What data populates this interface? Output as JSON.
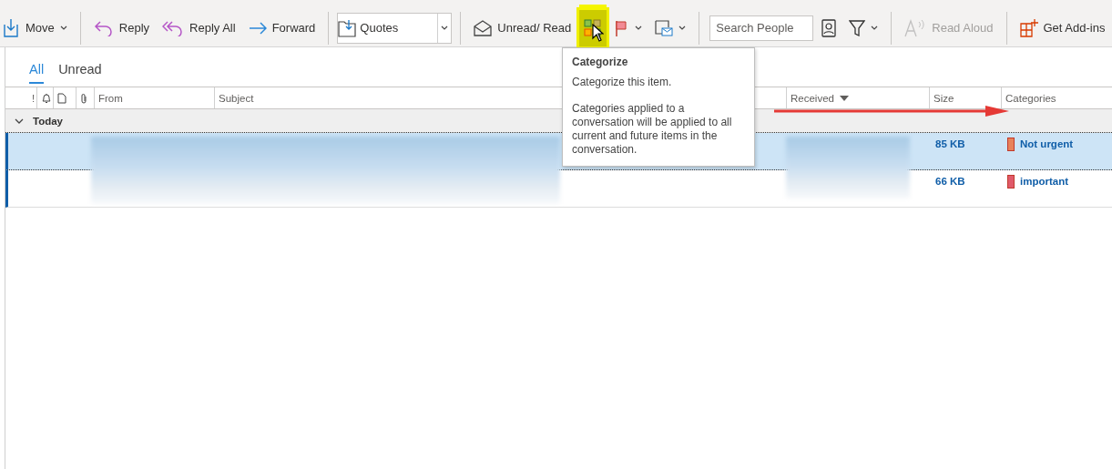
{
  "toolbar": {
    "groups": [
      [
        {
          "kind": "button",
          "label": "Move",
          "dropdown": true,
          "disabled": false,
          "highlighted": false
        }
      ],
      [
        {
          "kind": "button",
          "label": "Reply",
          "dropdown": false,
          "disabled": false,
          "highlighted": false
        },
        {
          "kind": "button",
          "label": "Reply All",
          "dropdown": false,
          "disabled": false,
          "highlighted": false
        },
        {
          "kind": "button",
          "label": "Forward",
          "dropdown": false,
          "disabled": false,
          "highlighted": false
        }
      ],
      [
        {
          "kind": "combo",
          "label": "Quotes"
        }
      ],
      [
        {
          "kind": "button",
          "label": "Unread/ Read",
          "dropdown": false,
          "disabled": false,
          "highlighted": false
        },
        {
          "kind": "icon",
          "dropdown": false,
          "disabled": false,
          "highlighted": true
        },
        {
          "kind": "icon",
          "dropdown": true,
          "disabled": false,
          "highlighted": false
        },
        {
          "kind": "icon",
          "dropdown": true,
          "disabled": false,
          "highlighted": false
        }
      ],
      [
        {
          "kind": "search",
          "placeholder": "Search People"
        },
        {
          "kind": "icon",
          "dropdown": false,
          "disabled": false,
          "highlighted": false
        },
        {
          "kind": "icon",
          "dropdown": true,
          "disabled": false,
          "highlighted": false
        }
      ],
      [
        {
          "kind": "button",
          "label": "Read Aloud",
          "dropdown": false,
          "disabled": true,
          "highlighted": false
        }
      ],
      [
        {
          "kind": "button",
          "label": "Get Add-ins",
          "dropdown": false,
          "disabled": false,
          "highlighted": false
        }
      ]
    ]
  },
  "tooltip": {
    "title": "Categorize",
    "lines": [
      "Categorize this item.",
      "Categories applied to a conversation will be applied to all current and future items in the conversation."
    ]
  },
  "tabs": [
    {
      "label": "All",
      "selected": true
    },
    {
      "label": "Unread",
      "selected": false
    }
  ],
  "columns": [
    {
      "kind": "text",
      "label": "!"
    },
    {
      "kind": "icon"
    },
    {
      "kind": "icon"
    },
    {
      "kind": "icon"
    },
    {
      "kind": "text",
      "label": "From"
    },
    {
      "kind": "text",
      "label": "Subject"
    },
    {
      "kind": "text",
      "label": "Received",
      "sorted": true
    },
    {
      "kind": "text",
      "label": "Size"
    },
    {
      "kind": "text",
      "label": "Categories"
    }
  ],
  "group": {
    "label": "Today",
    "expanded": true
  },
  "rows": [
    {
      "selected": true,
      "size": "85 KB",
      "category": {
        "name": "Not urgent",
        "color": "#e8825a"
      }
    },
    {
      "selected": false,
      "size": "66 KB",
      "category": {
        "name": "important",
        "color": "#e05a6a"
      }
    }
  ]
}
